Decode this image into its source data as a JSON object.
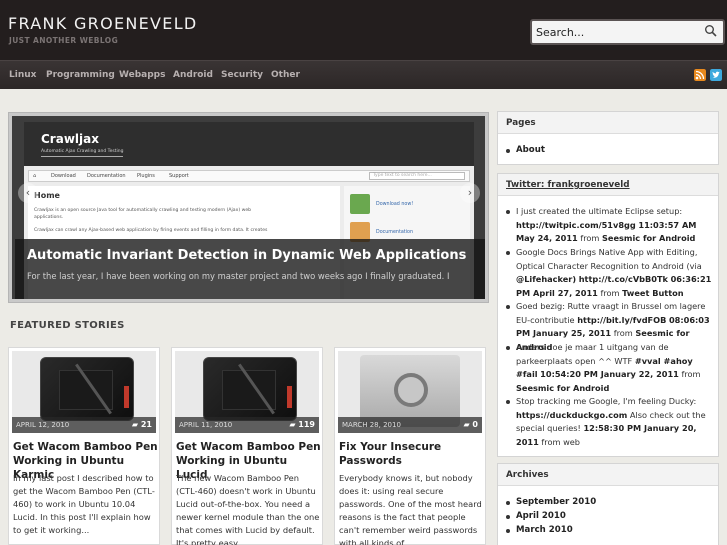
{
  "header": {
    "site_title": "FRANK GROENEVELD",
    "site_description": "JUST ANOTHER WEBLOG",
    "search_value": "Search..."
  },
  "nav": {
    "items": [
      "Linux",
      "Programming",
      "Webapps",
      "Android",
      "Security",
      "Other"
    ],
    "icons": [
      "rss-icon",
      "twitter-icon"
    ]
  },
  "slider": {
    "title": "Automatic Invariant Detection in Dynamic Web Applications",
    "excerpt": "For the last year, I have been working on my master project and two weeks ago I finally graduated. I",
    "image": {
      "app_title": "Crawljax",
      "app_subtitle": "Automatic Ajax Crawling and Testing",
      "tabs": [
        "Download",
        "Documentation",
        "Plugins",
        "Support"
      ],
      "search_placeholder": "Type text to search here...",
      "heading": "Home",
      "lines": [
        "Crawljax is an open source Java tool for automatically crawling and testing modern (Ajax) web",
        "applications.",
        "Crawljax can crawl any Ajax-based web application by firing events and filling in form data. It creates"
      ],
      "side_links": [
        "Download now!",
        "Documentation"
      ]
    }
  },
  "featured": {
    "heading": "FEATURED STORIES",
    "cards": [
      {
        "date": "APRIL 12, 2010",
        "comments": "21",
        "title": "Get Wacom Bamboo Pen Working in Ubuntu Karmic",
        "excerpt": "In my last post I described how to get the Wacom Bamboo Pen (CTL-460) to work in Ubuntu 10.04 Lucid. In this post I'll explain how to get it working..."
      },
      {
        "date": "APRIL 11, 2010",
        "comments": "119",
        "title": "Get Wacom Bamboo Pen Working in Ubuntu Lucid",
        "excerpt": "The new Wacom Bamboo Pen (CTL-460) doesn't work in Ubuntu Lucid out-of-the-box. You need a newer kernel module than the one that comes with Lucid by default. It's pretty easy..."
      },
      {
        "date": "MARCH 28, 2010",
        "comments": "0",
        "title": "Fix Your Insecure Passwords",
        "excerpt": "Everybody knows it, but nobody does it: using real secure passwords. One of the most heard reasons is the fact that people can't remember weird passwords with all kinds of..."
      }
    ]
  },
  "sidebar": {
    "pages": {
      "title": "Pages",
      "items": [
        "About"
      ]
    },
    "twitter": {
      "title": "Twitter: frankgroeneveld",
      "tweets": [
        {
          "text": "I just created the ultimate Eclipse setup:",
          "link": "http://twitpic.com/51v8gg",
          "time": "11:03:57 AM May 24, 2011",
          "from_label": "from",
          "source": "Seesmic for Android"
        },
        {
          "text": "Google Docs Brings Native App with Editing, Optical Character Recognition to Android (via",
          "mention": "@Lifehacker)",
          "link": "http://t.co/cVbB0Tk",
          "time": "06:36:21 PM April 27, 2011",
          "from_label": "from",
          "source": "Tweet Button"
        },
        {
          "text": "Goed bezig: Rutte vraagt in Brussel om lagere EU-contributie",
          "link": "http://bit.ly/fvdFOB",
          "time": "08:06:03 PM January 25, 2011",
          "from_label": "from",
          "source": "Seesmic for Android"
        },
        {
          "text": "Anders doe je maar 1 uitgang van de parkeerplaats open ^^ WTF",
          "tags": "#vval #ahoy #fail",
          "time": "10:54:20 PM January 22, 2011",
          "from_label": "from",
          "source": "Seesmic for Android"
        },
        {
          "text": "Stop tracking me Google, I'm feeling Ducky:",
          "link": "https://duckduckgo.com",
          "text2": "Also check out the special queries!",
          "time": "12:58:30 PM January 20, 2011",
          "from_label": "from",
          "source": "web"
        }
      ]
    },
    "archives": {
      "title": "Archives",
      "items": [
        "September 2010",
        "April 2010",
        "March 2010"
      ]
    }
  },
  "colors": {
    "header_bg": "#231e1e",
    "nav_bg": "#2c2727",
    "page_bg": "#ecebe6",
    "rss": "#e8891d",
    "twitter": "#3ea9dd"
  }
}
